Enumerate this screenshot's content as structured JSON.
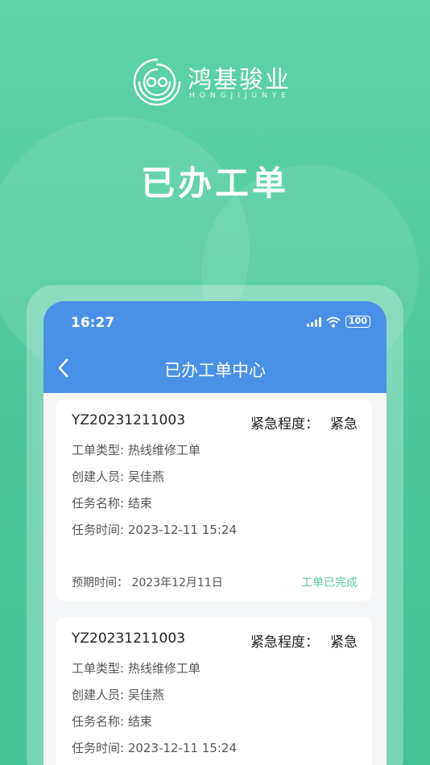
{
  "brand": {
    "name": "鸿基骏业",
    "subtitle": "HONGJIJUNYE"
  },
  "hero": {
    "title": "已办工单"
  },
  "status_bar": {
    "time": "16:27",
    "battery": "100"
  },
  "nav": {
    "title": "已办工单中心"
  },
  "colors": {
    "primary": "#4a90e8",
    "accent_green": "#5cc8a4",
    "background_green": "#4bc79b"
  },
  "orders": [
    {
      "id": "YZ20231211003",
      "urgency_label": "紧急程度：",
      "urgency": "紧急",
      "type": "工单类型: 热线维修工单",
      "creator": "创建人员: 吴佳燕",
      "task_name": "任务名称: 结束",
      "task_time": "任务时间: 2023-12-11 15:24",
      "due": "预期时间：  2023年12月11日",
      "status": "工单已完成"
    },
    {
      "id": "YZ20231211003",
      "urgency_label": "紧急程度：",
      "urgency": "紧急",
      "type": "工单类型: 热线维修工单",
      "creator": "创建人员: 吴佳燕",
      "task_name": "任务名称: 结束",
      "task_time": "任务时间: 2023-12-11 15:24"
    }
  ]
}
